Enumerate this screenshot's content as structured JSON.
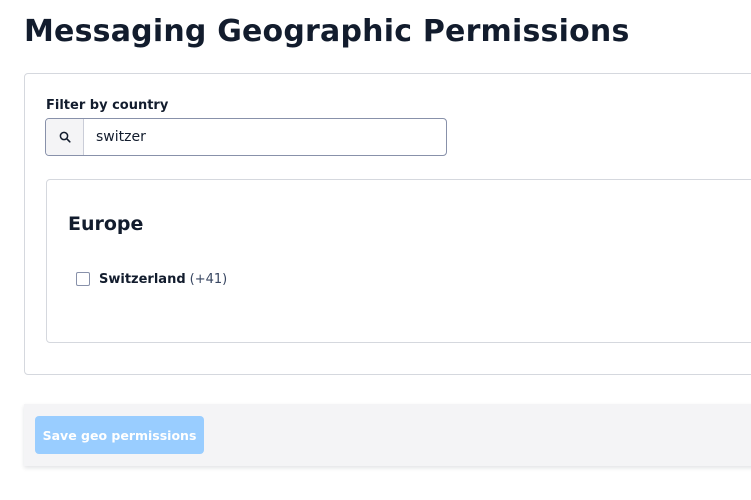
{
  "page": {
    "title": "Messaging Geographic Permissions"
  },
  "filter": {
    "label": "Filter by country",
    "value": "switzer",
    "search_icon": "search-icon"
  },
  "regions": [
    {
      "name": "Europe",
      "countries": [
        {
          "name": "Switzerland",
          "code": "(+41)",
          "checked": false
        }
      ]
    }
  ],
  "footer": {
    "save_label": "Save geo permissions",
    "save_disabled": true
  },
  "colors": {
    "text": "#121c2d",
    "border": "#d5d8de",
    "button_disabled": "#99cdff",
    "footer_bg": "#f4f4f6"
  }
}
